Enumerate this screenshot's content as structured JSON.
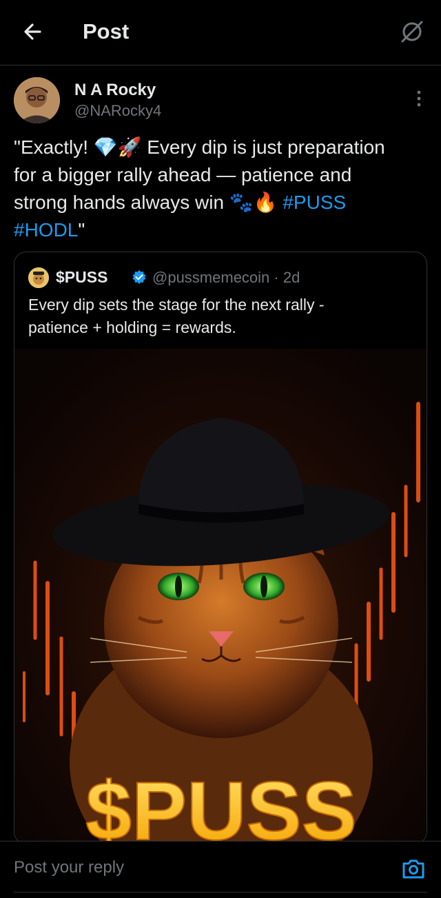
{
  "header": {
    "title": "Post",
    "back_icon": "arrow-left-icon",
    "grok_icon": "grok-icon"
  },
  "author": {
    "name": "N A Rocky",
    "handle": "@NARocky4",
    "more_icon": "more-vertical-icon"
  },
  "post": {
    "line1": "\"Exactly! 💎🚀 Every dip is just preparation",
    "line2": "for a bigger rally ahead — patience and",
    "line3_text": "strong hands always win 🐾🔥 ",
    "line3_hashtag": "#PUSS",
    "line4_hashtag": "#HODL",
    "line4_tail": "\""
  },
  "quote": {
    "name": "$PUSS",
    "handle": "@pussmemecoin · 2d",
    "text_line1": "Every dip sets the stage for the next rally -",
    "text_line2": "patience + holding = rewards.",
    "image_caption": "$PUSS",
    "verified_color": "#1d9bf0"
  },
  "reply": {
    "placeholder": "Post your reply",
    "camera_icon": "camera-icon"
  },
  "colors": {
    "background": "#000000",
    "text": "#e7e9ea",
    "secondary": "#71767b",
    "accent": "#1d9bf0",
    "border": "#2f3336"
  }
}
